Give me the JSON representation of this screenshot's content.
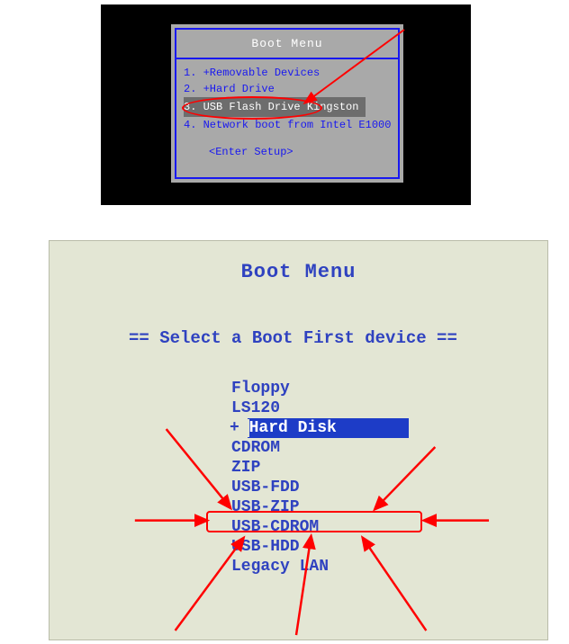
{
  "top": {
    "title": "Boot Menu",
    "items": [
      "1.   +Removable Devices",
      "2.   +Hard Drive",
      "3.   USB Flash Drive Kingston",
      "4.   Network boot from Intel E1000"
    ],
    "enter_setup": "<Enter Setup>",
    "highlighted_index": 2,
    "annotation_target_index": 2
  },
  "bottom": {
    "title": "Boot Menu",
    "subtitle": "== Select a Boot First device ==",
    "items": [
      "Floppy",
      "LS120",
      "Hard Disk",
      "CDROM",
      "ZIP",
      "USB-FDD",
      "USB-ZIP",
      "USB-CDROM",
      "USB-HDD",
      "Legacy LAN"
    ],
    "selected_index": 2,
    "annotation_target_index": 8
  },
  "annotation_color": "#ff0000"
}
